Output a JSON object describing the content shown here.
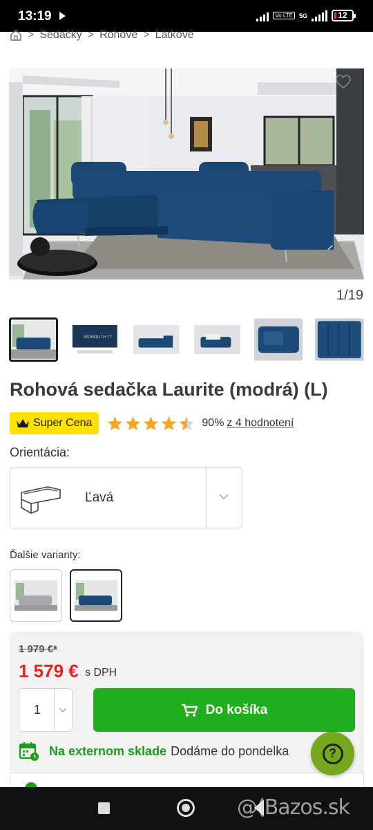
{
  "status_bar": {
    "time": "13:19",
    "network": "5G",
    "volte": "Vo LTE",
    "battery": "12"
  },
  "breadcrumb": {
    "items": [
      "Sedačky",
      "Rohové",
      "Látkové"
    ],
    "separator": ">"
  },
  "gallery": {
    "counter": "1/19",
    "thumb_label": "MONOLITH 77"
  },
  "product": {
    "title": "Rohová sedačka Laurite (modrá) (L)",
    "badge": "Super Cena",
    "rating_stars": 4.5,
    "rating_percent": "90%",
    "rating_link": "z 4 hodnotení"
  },
  "orientation": {
    "label": "Orientácia:",
    "selected": "Ľavá"
  },
  "variants": {
    "label": "Ďalšie varianty:",
    "count": 2,
    "selected_index": 1
  },
  "pricing": {
    "old_price": "1 979 €*",
    "price": "1 579 €",
    "vat_note": "s DPH",
    "quantity": "1",
    "cart_button": "Do košíka"
  },
  "stock": {
    "status": "Na externom sklade",
    "delivery": "Dodáme do pondelka"
  },
  "help": {
    "label": "?"
  },
  "watermark": "@(Bazos.sk",
  "colors": {
    "price_red": "#e52421",
    "cart_green": "#1eae1e",
    "stock_green": "#1a9e1a",
    "badge_yellow": "#ffe000",
    "star_orange": "#f5a623",
    "help_green": "#76a81e",
    "sofa_blue": "#1c4a77"
  }
}
